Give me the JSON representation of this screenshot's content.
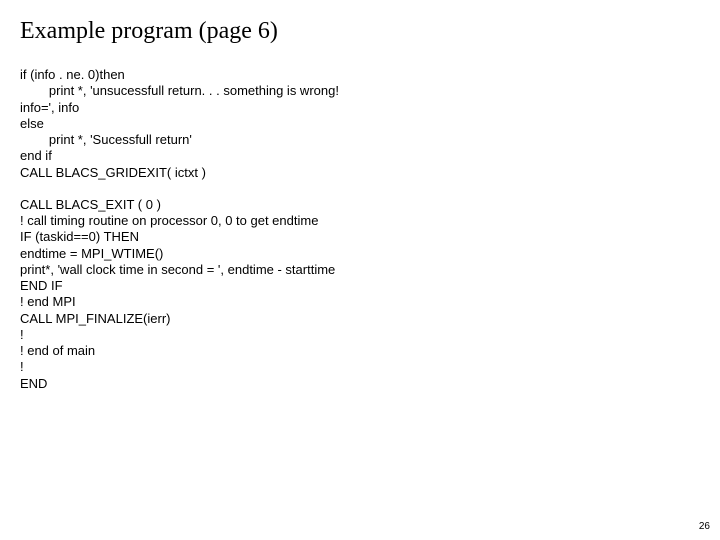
{
  "title": "Example program (page 6)",
  "code_block_1": "if (info . ne. 0)then\n        print *, 'unsucessfull return. . . something is wrong!\ninfo=', info\nelse\n        print *, 'Sucessfull return'\nend if\nCALL BLACS_GRIDEXIT( ictxt )",
  "code_block_2": "CALL BLACS_EXIT ( 0 )\n! call timing routine on processor 0, 0 to get endtime\nIF (taskid==0) THEN\nendtime = MPI_WTIME()\nprint*, 'wall clock time in second = ', endtime - starttime\nEND IF\n! end MPI\nCALL MPI_FINALIZE(ierr)\n!\n! end of main\n!\nEND",
  "page_number": "26"
}
